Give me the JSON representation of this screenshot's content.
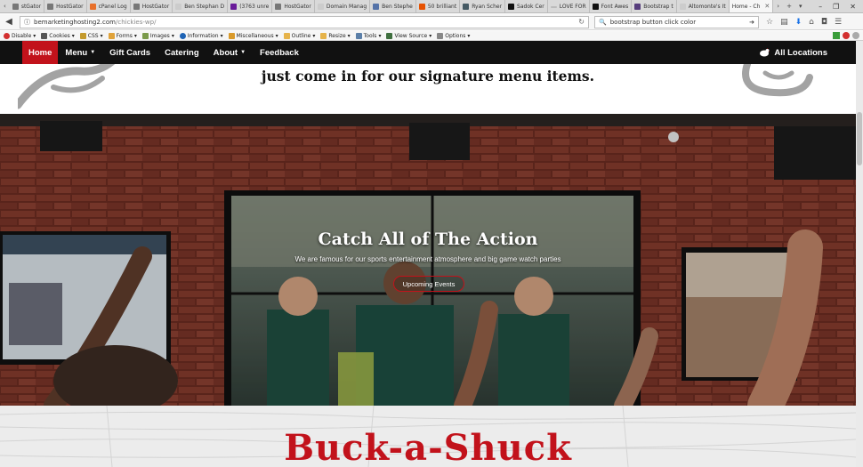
{
  "browser": {
    "tabs": [
      {
        "label": "stGator"
      },
      {
        "label": "HostGator"
      },
      {
        "label": "cPanel Log"
      },
      {
        "label": "HostGator"
      },
      {
        "label": "Ben Stephan D"
      },
      {
        "label": "(3763 unre"
      },
      {
        "label": "HostGator"
      },
      {
        "label": "Domain Manag"
      },
      {
        "label": "Ben Stephe"
      },
      {
        "label": "50 brilliant"
      },
      {
        "label": "Ryan Scher"
      },
      {
        "label": "Sadok Cer"
      },
      {
        "label": "LOVE FOR"
      },
      {
        "label": "Font Awes"
      },
      {
        "label": "Bootstrap t"
      },
      {
        "label": "Altomonte's It"
      },
      {
        "label": "Home - Ch"
      }
    ],
    "url_host": "bemarketinghosting2.com",
    "url_path": "/chickies-wp/",
    "search_value": "bootstrap button click color",
    "webdev_toolbar": [
      "Disable",
      "Cookies",
      "CSS",
      "Forms",
      "Images",
      "Information",
      "Miscellaneous",
      "Outline",
      "Resize",
      "Tools",
      "View Source",
      "Options"
    ]
  },
  "site": {
    "nav": {
      "home": "Home",
      "menu": "Menu",
      "gift_cards": "Gift Cards",
      "catering": "Catering",
      "about": "About",
      "feedback": "Feedback",
      "locations": "All Locations"
    },
    "strip_heading": "just come in for our signature menu items.",
    "hero": {
      "title": "Catch All of The Action",
      "subtitle": "We are famous for our sports entertainment atmosphere and big game watch parties",
      "button": "Upcoming Events"
    },
    "section_title": "Buck-a-Shuck"
  },
  "colors": {
    "brand_red": "#c2121b",
    "nav_bg": "#111111",
    "brick": "#8a3a2c"
  }
}
